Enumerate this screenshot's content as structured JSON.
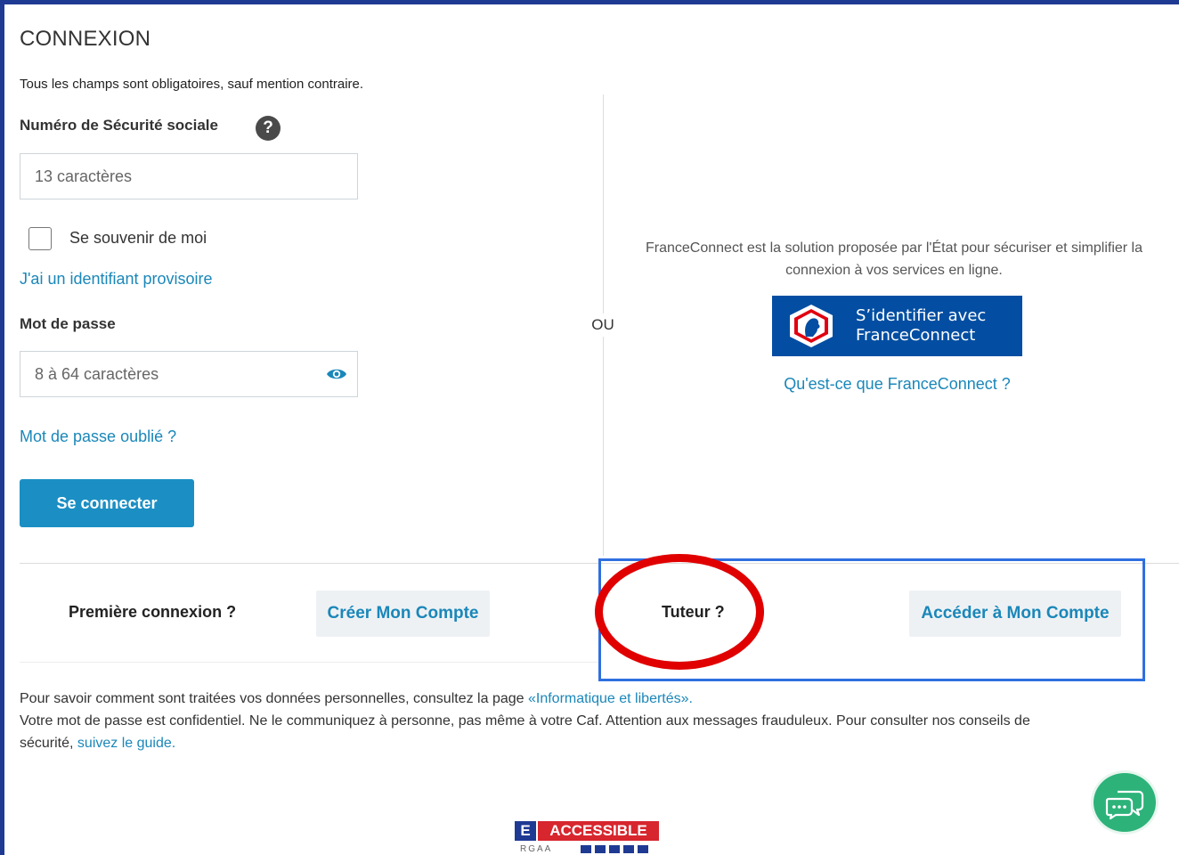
{
  "page": {
    "title": "CONNEXION",
    "required_note": "Tous les champs sont obligatoires, sauf mention contraire."
  },
  "login": {
    "nss_label": "Numéro de Sécurité sociale",
    "nss_placeholder": "13 caractères",
    "nss_value": "",
    "help_icon": "?",
    "remember_label": "Se souvenir de moi",
    "remember_checked": false,
    "temp_id_link": "J'ai un identifiant provisoire",
    "password_label": "Mot de passe",
    "password_placeholder": "8 à 64 caractères",
    "password_value": "",
    "password_icon": "eye-icon",
    "forgot_link": "Mot de passe oublié ?",
    "submit_label": "Se connecter"
  },
  "separator": "OU",
  "franceconnect": {
    "description_line1": "FranceConnect est la solution proposée par l'État pour sécuriser et simplifier la",
    "description_line2": "connexion à vos services en ligne.",
    "button_line1": "S’identifier avec",
    "button_line2": "FranceConnect",
    "info_link": "Qu'est-ce que FranceConnect ?"
  },
  "bottom": {
    "first_question": "Première connexion ?",
    "create_button": "Créer Mon Compte",
    "tutor_question": "Tuteur ?",
    "access_button": "Accéder à Mon Compte"
  },
  "footer": {
    "privacy_text": "Pour savoir comment sont traitées vos données personnelles, consultez la page ",
    "privacy_link": "«Informatique et libertés».",
    "security_text_line1": "Votre mot de passe est confidentiel. Ne le communiquez à personne, pas même à votre Caf. Attention aux messages frauduleux. Pour consulter nos conseils de",
    "security_text_line2": "sécurité, ",
    "guide_link": "suivez le guide."
  },
  "badge": {
    "letter": "E",
    "word": "ACCESSIBLE",
    "sub": "RGAA"
  },
  "chat": {
    "icon": "chat-bubbles-icon"
  },
  "colors": {
    "primary": "#1b8fc4",
    "link": "#1a87b9",
    "franceconnect": "#034ea2",
    "highlight_box": "#2f6fe0",
    "highlight_ellipse": "#e00000",
    "chat": "#2db37a"
  }
}
